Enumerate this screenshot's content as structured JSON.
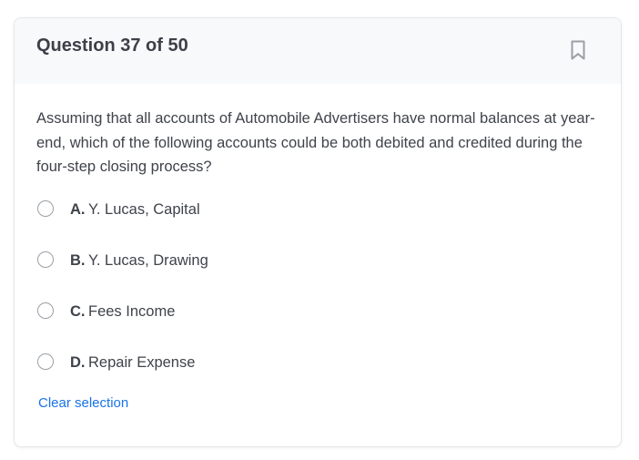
{
  "question": {
    "title": "Question 37 of 50",
    "text": "Assuming that all accounts of Automobile Advertisers have normal balances at year-end, which of the following accounts could be both debited and credited during the four-step closing process?",
    "bookmark_icon": "bookmark-icon"
  },
  "options": [
    {
      "letter": "A.",
      "label": "Y. Lucas, Capital",
      "selected": false
    },
    {
      "letter": "B.",
      "label": "Y. Lucas, Drawing",
      "selected": false
    },
    {
      "letter": "C.",
      "label": "Fees Income",
      "selected": false
    },
    {
      "letter": "D.",
      "label": "Repair Expense",
      "selected": false
    }
  ],
  "actions": {
    "clear_label": "Clear selection"
  },
  "colors": {
    "link": "#1a73e8",
    "text": "#3f434a",
    "header_bg": "#f8f9fa"
  }
}
